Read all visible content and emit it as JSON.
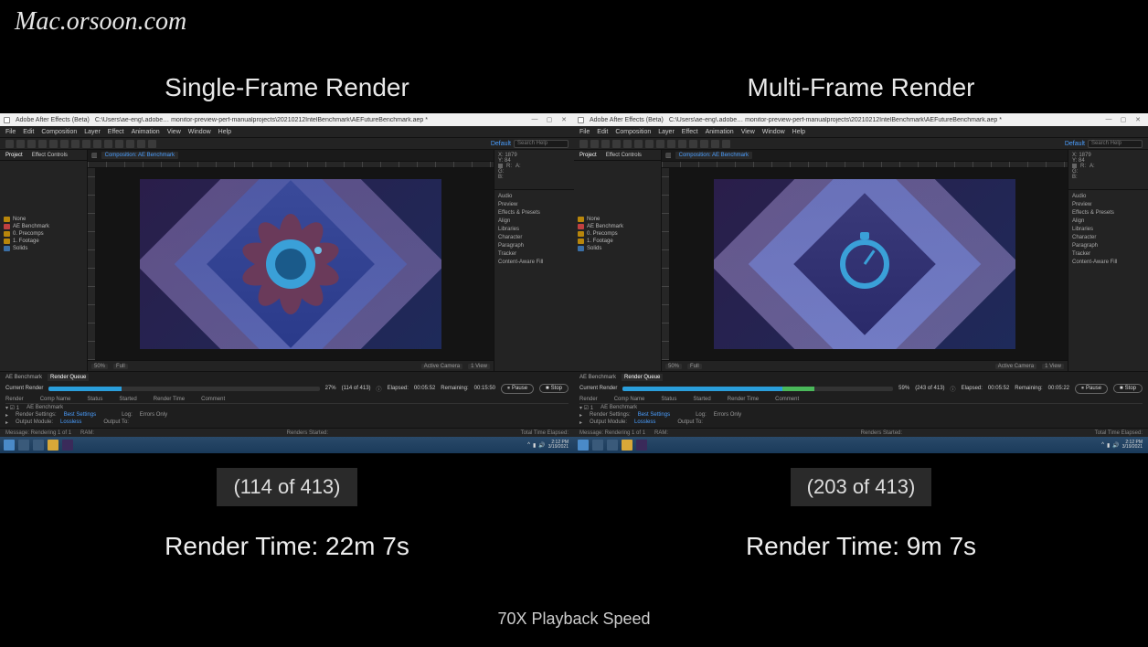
{
  "watermark": "Mac.orsoon.com",
  "playback_speed": "70X Playback Speed",
  "menus": [
    "File",
    "Edit",
    "Composition",
    "Layer",
    "Effect",
    "Animation",
    "View",
    "Window",
    "Help"
  ],
  "toolbar": {
    "workspace_label": "Default",
    "search_placeholder": "Search Help"
  },
  "viewer_footer": {
    "zoom": "50%",
    "res": "Full",
    "camera": "Active Camera",
    "view": "1 View"
  },
  "right_panels": [
    "Audio",
    "Preview",
    "Effects & Presets",
    "Align",
    "Libraries",
    "Character",
    "Paragraph",
    "Tracker",
    "Content-Aware Fill"
  ],
  "render_queue": {
    "tab_comp": "AE Benchmark",
    "tab_rq": "Render Queue",
    "current_render_label": "Current Render",
    "elapsed_label": "Elapsed:",
    "remaining_label": "Remaining:",
    "pause_label": "Pause",
    "stop_label": "Stop",
    "th_render": "Render",
    "th_comp": "Comp Name",
    "th_status": "Status",
    "th_started": "Started",
    "th_rendertime": "Render Time",
    "th_comment": "Comment",
    "row_comp": "AE Benchmark",
    "row_rs": "Render Settings:",
    "row_rs_val": "Best Settings",
    "row_om": "Output Module:",
    "row_om_val": "Lossless",
    "row_log": "Log:",
    "row_log_val": "Errors Only",
    "row_out": "Output To:"
  },
  "info": {
    "x": "X: 1879",
    "y": "Y: 84",
    "r": "R:",
    "g": "G:",
    "b": "B:",
    "a": "A:"
  },
  "statusbar": {
    "msg": "Message: Rendering 1 of 1",
    "ram": "RAM:",
    "started": "Renders Started:",
    "total": "Total Time Elapsed:"
  },
  "taskbar": {
    "time": "2:12 PM",
    "date": "3/19/2021"
  },
  "project": {
    "tab_project": "Project",
    "tab_ec": "Effect Controls",
    "composition_tab": "Composition: AE Benchmark",
    "folders": [
      "None",
      "AE Benchmark",
      "0. Precomps",
      "1. Footage",
      "Solids"
    ]
  },
  "left": {
    "title_app": "Adobe After Effects (Beta)",
    "title_path": "C:\\Users\\ae-eng\\.adobe… monitor-preview-perf-manualprojects\\20210212IntelBenchmark\\AEFutureBenchmark.aep *",
    "pane_title": "Single-Frame Render",
    "percent": "27%",
    "frames": "(114 of 413)",
    "elapsed": "00:05:52",
    "remaining": "00:15:50",
    "counter": "(114 of 413)",
    "render_time": "Render Time: 22m 7s",
    "progress_fill": "27%"
  },
  "right": {
    "title_app": "Adobe After Effects (Beta)",
    "title_path": "C:\\Users\\ae-eng\\.adobe… monitor-preview-perf-manualprojects\\20210212IntelBenchmark\\AEFutureBenchmark.aep *",
    "pane_title": "Multi-Frame Render",
    "percent": "59%",
    "frames": "(243 of 413)",
    "elapsed": "00:05:52",
    "remaining": "00:05:22",
    "counter": "(203 of 413)",
    "render_time": "Render Time: 9m 7s",
    "progress_fill": "59%"
  }
}
